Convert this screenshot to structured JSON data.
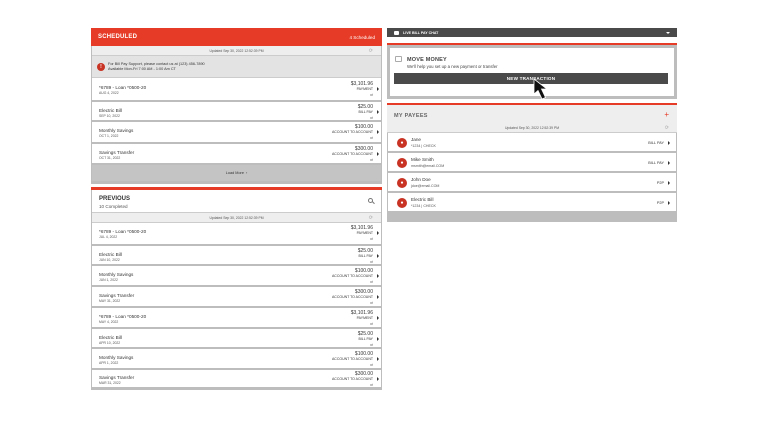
{
  "scheduled": {
    "title": "Scheduled",
    "count_label": "4 Scheduled",
    "updated": "Updated Sep 30, 2022 12:52:39 PM",
    "alert": {
      "line1": "For Bill Pay Support, please contact us at (123) 456-7890",
      "line2": "Available Mon-Fri 7:00 AM - 1:00 Am CT"
    },
    "items": [
      {
        "name": "*6789 - Loan *0500-20",
        "date": "AUG 4, 2022",
        "amount": "$3,101.96",
        "type": "PAYMENT"
      },
      {
        "name": "Electric Bill",
        "date": "SEP 10, 2022",
        "amount": "$25.00",
        "type": "BILL PAY"
      },
      {
        "name": "Monthly Savings",
        "date": "OCT 1, 2022",
        "amount": "$100.00",
        "type": "ACCOUNT TO ACCOUNT"
      },
      {
        "name": "Savings Transfer",
        "date": "OCT 31, 2022",
        "amount": "$300.00",
        "type": "ACCOUNT TO ACCOUNT"
      }
    ],
    "load_more": "Load More"
  },
  "previous": {
    "title": "Previous",
    "subtitle": "10 Completed",
    "updated": "Updated Sep 30, 2022 12:52:39 PM",
    "items": [
      {
        "name": "*6789 - Loan *0500-20",
        "date": "JUL 4, 2022",
        "amount": "$3,101.96",
        "type": "PAYMENT"
      },
      {
        "name": "Electric Bill",
        "date": "JUN 10, 2022",
        "amount": "$25.00",
        "type": "BILL PAY"
      },
      {
        "name": "Monthly Savings",
        "date": "JUN 1, 2022",
        "amount": "$100.00",
        "type": "ACCOUNT TO ACCOUNT"
      },
      {
        "name": "Savings Transfer",
        "date": "MAY 31, 2022",
        "amount": "$300.00",
        "type": "ACCOUNT TO ACCOUNT"
      },
      {
        "name": "*6789 - Loan *0500-20",
        "date": "MAY 4, 2022",
        "amount": "$3,101.96",
        "type": "PAYMENT"
      },
      {
        "name": "Electric Bill",
        "date": "APR 10, 2022",
        "amount": "$25.00",
        "type": "BILL PAY"
      },
      {
        "name": "Monthly Savings",
        "date": "APR 1, 2022",
        "amount": "$100.00",
        "type": "ACCOUNT TO ACCOUNT"
      },
      {
        "name": "Savings Transfer",
        "date": "MAR 31, 2022",
        "amount": "$300.00",
        "type": "ACCOUNT TO ACCOUNT"
      }
    ]
  },
  "chat": {
    "label": "LIVE BILL PAY CHAT"
  },
  "move_money": {
    "title": "MOVE MONEY",
    "subtitle": "We'll help you set up a new payment or transfer",
    "button": "NEW TRANSACTION"
  },
  "payees": {
    "title": "MY PAYEES",
    "updated": "Updated Sep 30, 2022 12:52:39 PM",
    "items": [
      {
        "name": "Jane",
        "detail": "*1234 | CHECK",
        "type": "BILL PAY"
      },
      {
        "name": "Mike Smith",
        "detail": "msmith@email.COM",
        "type": "BILL PAY"
      },
      {
        "name": "John Doe",
        "detail": "jdoe@email.COM",
        "type": "P2P"
      },
      {
        "name": "Electric Bill",
        "detail": "*1234 | CHECK",
        "type": "P2P"
      }
    ]
  },
  "colors": {
    "accent": "#e63b26",
    "dark": "#4a4a4a"
  },
  "icons": {
    "alert": "alert-circle-icon",
    "refresh": "refresh-icon",
    "repeat": "repeat-icon",
    "search": "search-icon",
    "chat": "chat-icon",
    "money": "money-icon",
    "add": "plus-icon",
    "cursor": "mouse-cursor-icon",
    "chevron": "chevron-right-icon"
  }
}
